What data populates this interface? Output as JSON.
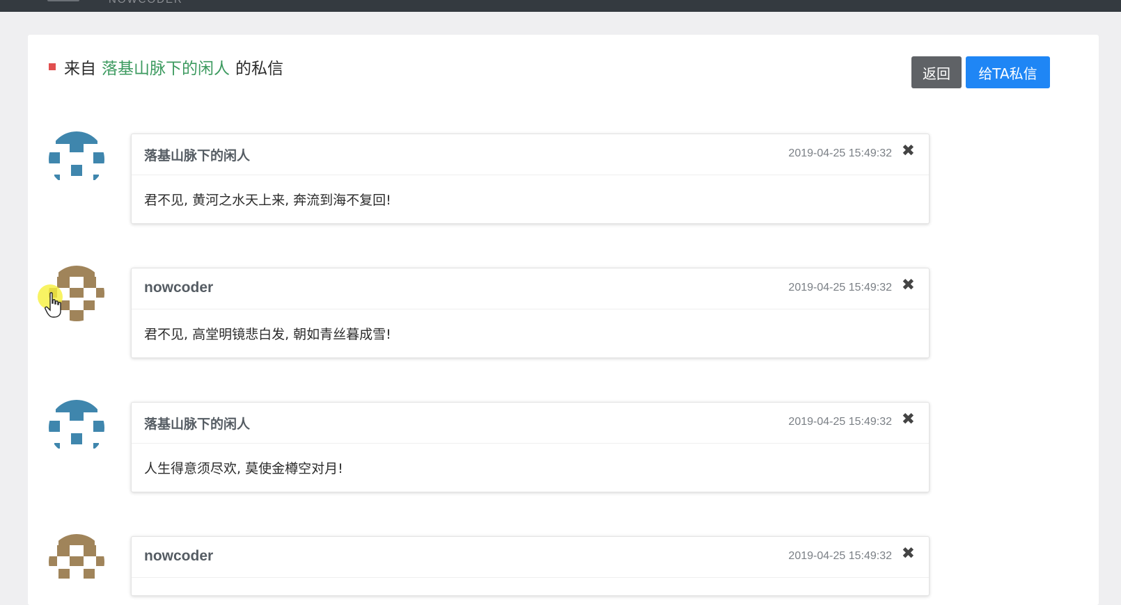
{
  "header": {
    "brand": "NOWCODER"
  },
  "page": {
    "title_prefix": "来自",
    "title_user": "落基山脉下的闲人",
    "title_suffix": "的私信",
    "back_button": "返回",
    "send_button": "给TA私信"
  },
  "messages": [
    {
      "sender": "落基山脉下的闲人",
      "time": "2019-04-25 15:49:32",
      "content": "君不见, 黄河之水天上来, 奔流到海不复回!",
      "avatar_color": "#3f86ad",
      "close": "✖"
    },
    {
      "sender": "nowcoder",
      "time": "2019-04-25 15:49:32",
      "content": "君不见, 高堂明镜悲白发, 朝如青丝暮成雪!",
      "avatar_color": "#a0845a",
      "close": "✖"
    },
    {
      "sender": "落基山脉下的闲人",
      "time": "2019-04-25 15:49:32",
      "content": "人生得意须尽欢, 莫使金樽空对月!",
      "avatar_color": "#3f86ad",
      "close": "✖"
    },
    {
      "sender": "nowcoder",
      "time": "2019-04-25 15:49:32",
      "content": "",
      "avatar_color": "#a0845a",
      "close": "✖"
    }
  ],
  "colors": {
    "accent": "#1f86f5",
    "secondary": "#5f6266",
    "username_green": "#3c9a5f",
    "title_marker": "#e14f4f"
  }
}
